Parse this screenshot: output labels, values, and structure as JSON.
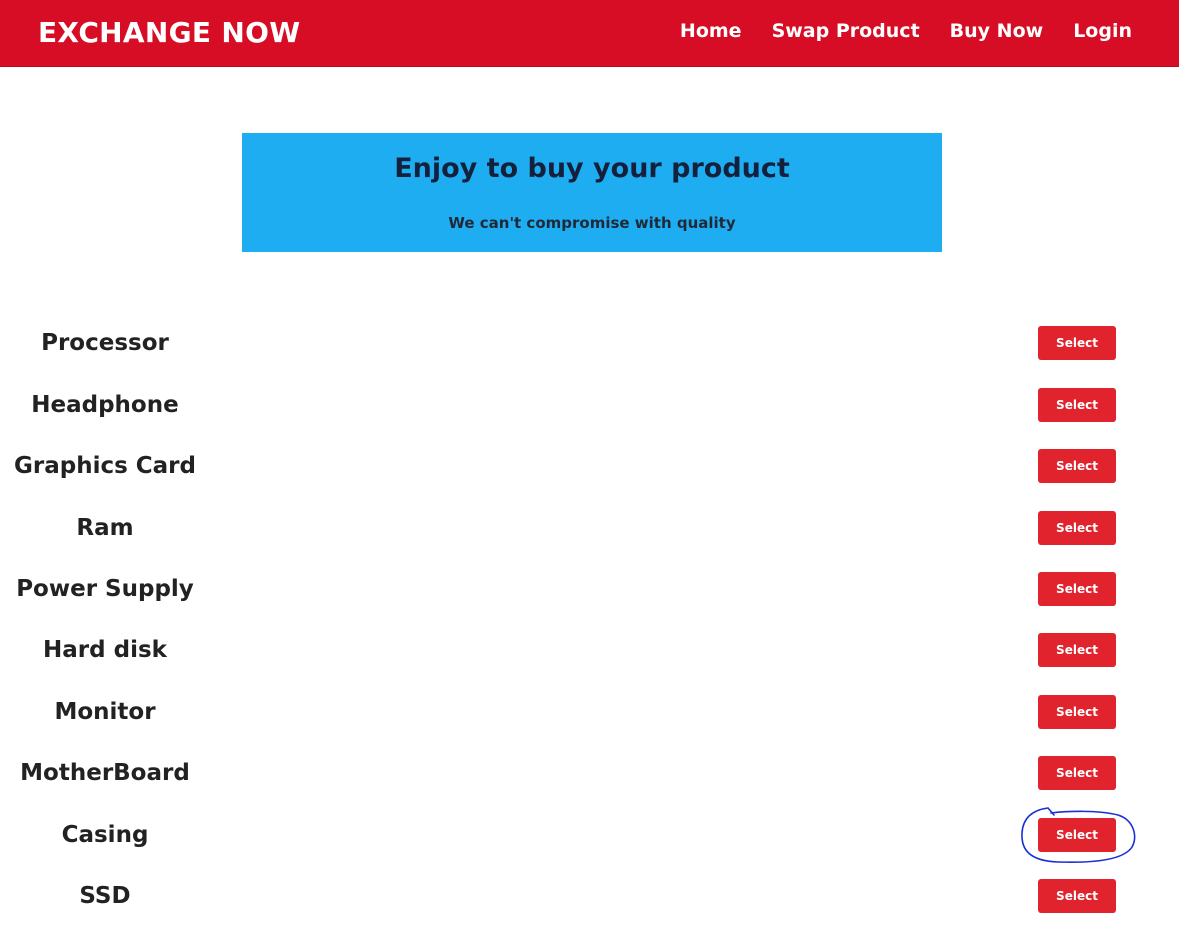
{
  "navbar": {
    "brand": "EXCHANGE NOW",
    "links": [
      "Home",
      "Swap Product",
      "Buy Now",
      "Login"
    ],
    "background_color": "#d60d25"
  },
  "hero": {
    "title": "Enjoy to buy your product",
    "subtitle": "We can't compromise with quality",
    "background_color": "#1fadf2"
  },
  "products": [
    {
      "name": "Processor",
      "button_label": "Select"
    },
    {
      "name": "Headphone",
      "button_label": "Select"
    },
    {
      "name": "Graphics Card",
      "button_label": "Select"
    },
    {
      "name": "Ram",
      "button_label": "Select"
    },
    {
      "name": "Power Supply",
      "button_label": "Select"
    },
    {
      "name": "Hard disk",
      "button_label": "Select"
    },
    {
      "name": "Monitor",
      "button_label": "Select"
    },
    {
      "name": "MotherBoard",
      "button_label": "Select"
    },
    {
      "name": "Casing",
      "button_label": "Select"
    },
    {
      "name": "SSD",
      "button_label": "Select"
    }
  ],
  "colors": {
    "select_button": "#e0232c",
    "annotation_circle": "#1a2fd6"
  }
}
